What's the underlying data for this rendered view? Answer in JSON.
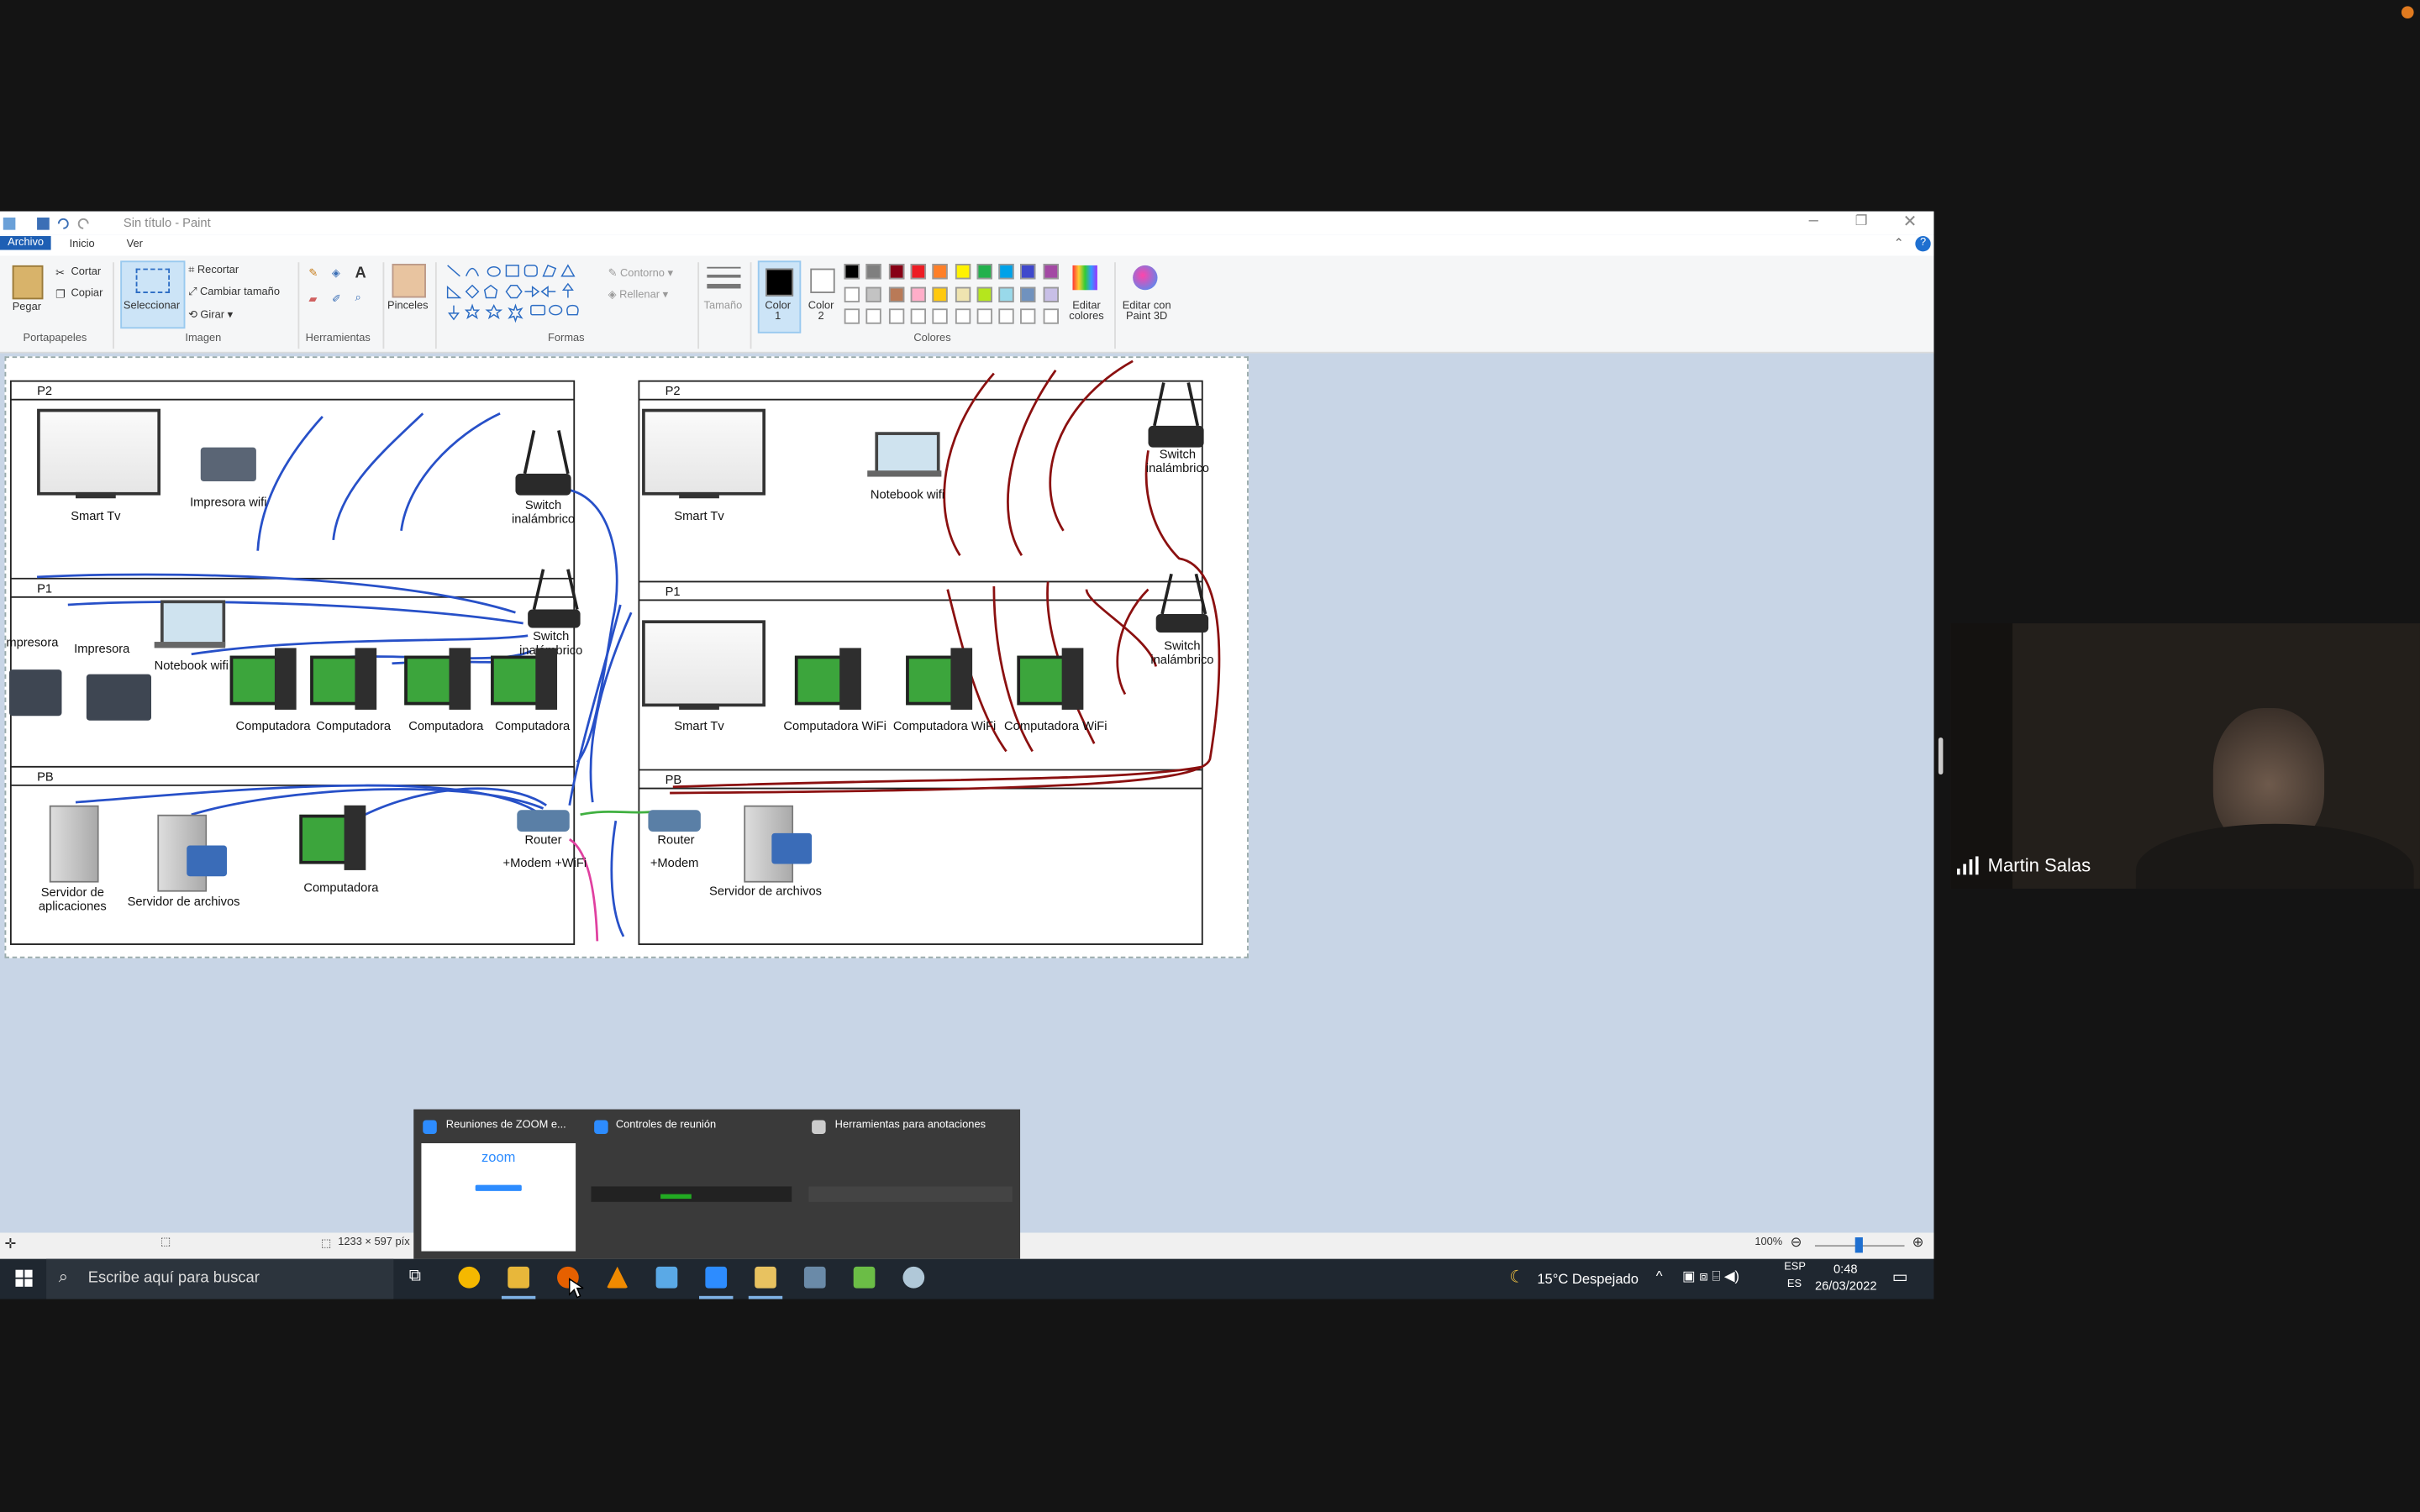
{
  "window": {
    "title": "Sin título - Paint"
  },
  "menu": {
    "tabs": [
      "Archivo",
      "Inicio",
      "Ver"
    ]
  },
  "ribbon": {
    "clipboard": {
      "paste": "Pegar",
      "cut": "Cortar",
      "copy": "Copiar",
      "group": "Portapapeles"
    },
    "image": {
      "select": "Seleccionar",
      "crop": "Recortar",
      "resize": "Cambiar tamaño",
      "rotate": "Girar",
      "group": "Imagen"
    },
    "tools": {
      "group": "Herramientas"
    },
    "brushes": {
      "label": "Pinceles"
    },
    "shapes": {
      "outline": "Contorno",
      "fill": "Rellenar",
      "group": "Formas"
    },
    "size": {
      "label": "Tamaño"
    },
    "colors": {
      "color1": "Color 1",
      "color2": "Color 2",
      "edit": "Editar colores",
      "group": "Colores"
    },
    "paint3d": {
      "label": "Editar con Paint 3D"
    }
  },
  "palette": [
    "#000000",
    "#7f7f7f",
    "#880015",
    "#ed1c24",
    "#ff7f27",
    "#fff200",
    "#22b14c",
    "#00a2e8",
    "#3f48cc",
    "#a349a4",
    "#ffffff",
    "#c3c3c3",
    "#b97a57",
    "#ffaec9",
    "#ffc90e",
    "#efe4b0",
    "#b5e61d",
    "#99d9ea",
    "#7092be",
    "#c8bfe7"
  ],
  "diagram": {
    "left": {
      "floors": [
        "P2",
        "P1",
        "PB"
      ],
      "labels": {
        "smart_tv": "Smart Tv",
        "printer_wifi": "Impresora wifi",
        "switch_top": "Switch inalámbrico",
        "printer_a": "mpresora",
        "printer_b": "Impresora",
        "notebook": "Notebook wifi",
        "switch_mid": "Switch inalámbrico",
        "pc1": "Computadora",
        "pc2": "Computadora",
        "pc3": "Computadora",
        "pc4": "Computadora",
        "app_server": "Servidor de aplicaciones",
        "file_server": "Servidor de archivos",
        "pc5": "Computadora",
        "router": "Router",
        "modem": "+Modem +WiFi"
      }
    },
    "right": {
      "floors": [
        "P2",
        "P1",
        "PB"
      ],
      "labels": {
        "smart_tv_top": "Smart Tv",
        "notebook": "Notebook wifi",
        "switch_top": "Switch inalámbrico",
        "smart_tv_mid": "Smart Tv",
        "pc_wifi1": "Computadora WiFi",
        "pc_wifi2": "Computadora WiFi",
        "pc_wifi3": "Computadora WiFi",
        "switch_mid": "Switch inalámbrico",
        "router": "Router",
        "modem": "+Modem",
        "file_server": "Servidor de archivos"
      }
    }
  },
  "statusbar": {
    "dimensions": "1233 × 597 píx",
    "zoom": "100%"
  },
  "zoom_preview": {
    "items": [
      "Reuniones de ZOOM e...",
      "Controles de reunión",
      "Herramientas para anotaciones"
    ],
    "logo": "zoom"
  },
  "taskbar": {
    "search_placeholder": "Escribe aquí para buscar",
    "weather": "15°C  Despejado",
    "lang": "ESP",
    "lang2": "ES",
    "time": "0:48",
    "date": "26/03/2022"
  },
  "video": {
    "participant": "Martin Salas"
  }
}
